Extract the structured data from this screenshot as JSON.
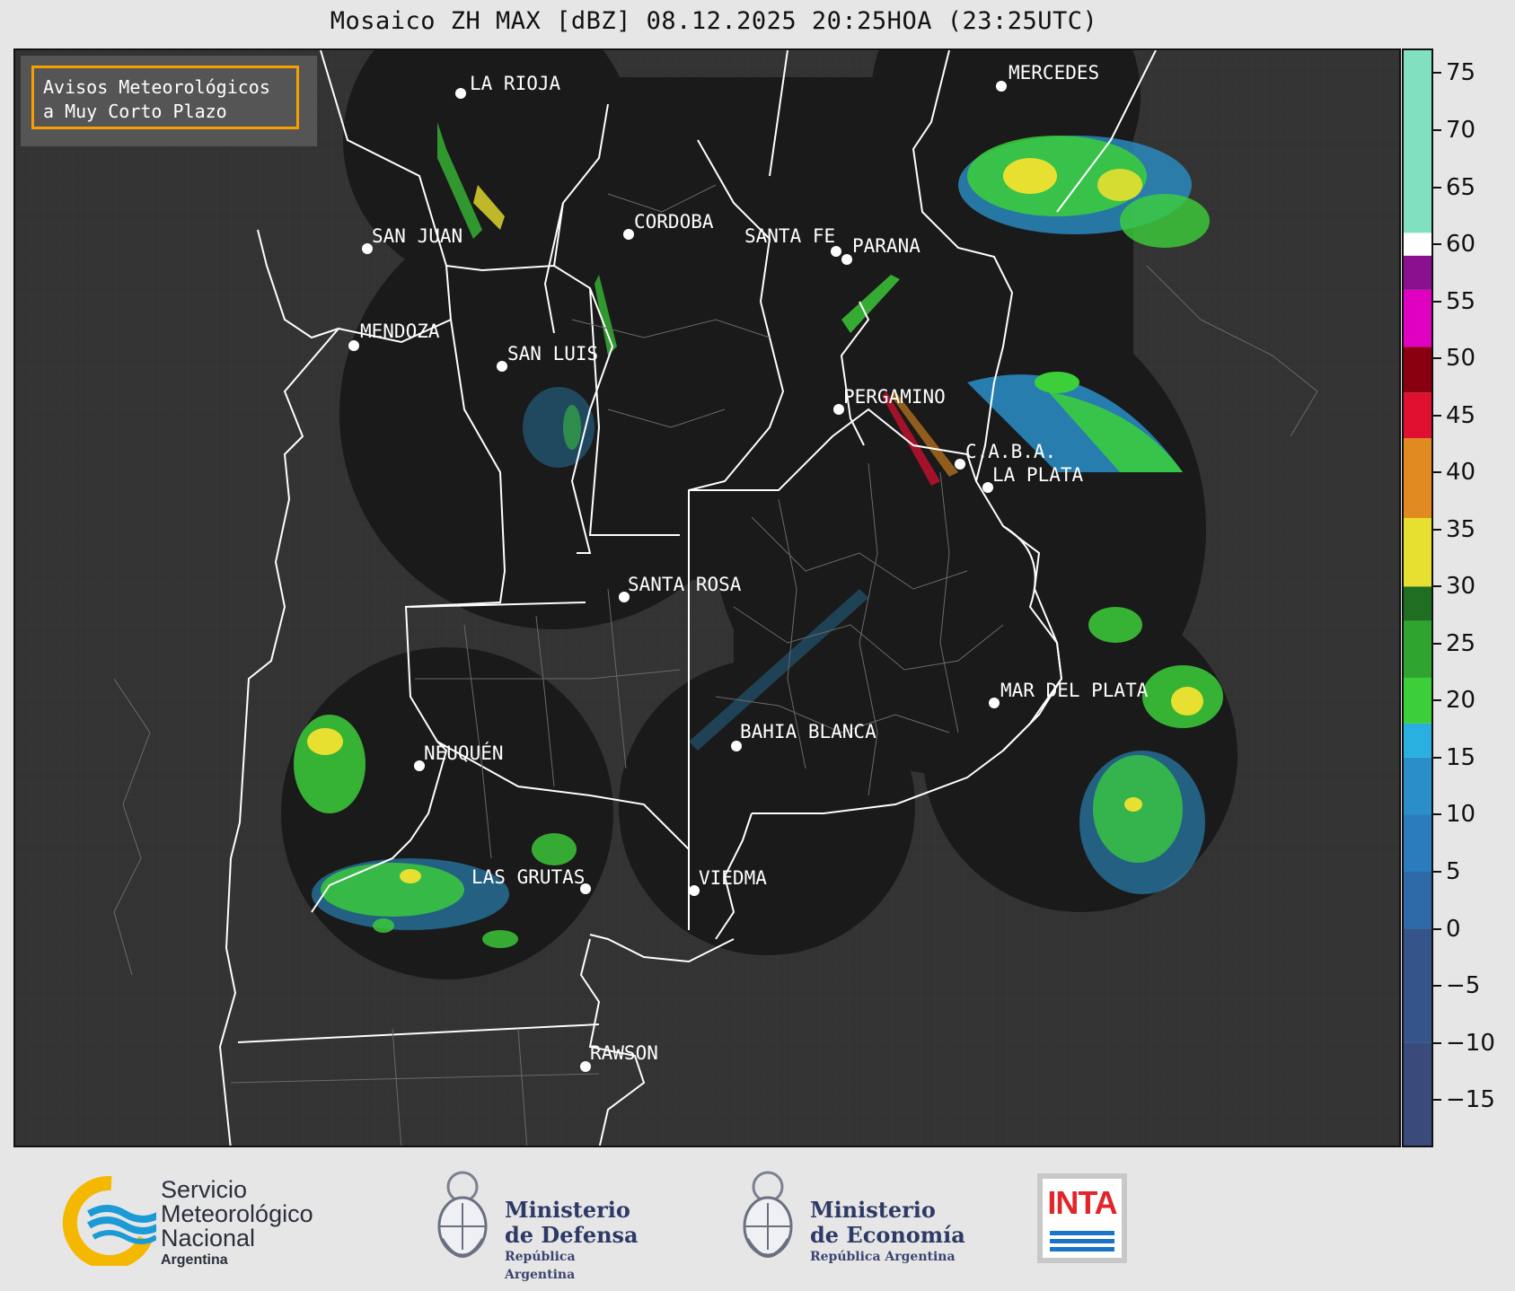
{
  "title": "Mosaico ZH MAX [dBZ] 08.12.2025 20:25HOA (23:25UTC)",
  "notice": {
    "line1": "Avisos Meteorológicos",
    "line2": "a Muy Corto Plazo"
  },
  "cities": [
    {
      "name": "LA RIOJA"
    },
    {
      "name": "SAN JUAN"
    },
    {
      "name": "CORDOBA"
    },
    {
      "name": "SANTA FE"
    },
    {
      "name": "PARANA"
    },
    {
      "name": "MERCEDES"
    },
    {
      "name": "MENDOZA"
    },
    {
      "name": "SAN LUIS"
    },
    {
      "name": "PERGAMINO"
    },
    {
      "name": "C.A.B.A."
    },
    {
      "name": "LA PLATA"
    },
    {
      "name": "SANTA ROSA"
    },
    {
      "name": "MAR DEL PLATA"
    },
    {
      "name": "BAHIA BLANCA"
    },
    {
      "name": "NEUQUÉN"
    },
    {
      "name": "LAS GRUTAS"
    },
    {
      "name": "VIEDMA"
    },
    {
      "name": "RAWSON"
    }
  ],
  "colorbar": {
    "unit": "dBZ",
    "min": -19,
    "max": 77,
    "ticks": [
      75,
      70,
      65,
      60,
      55,
      50,
      45,
      40,
      35,
      30,
      25,
      20,
      15,
      10,
      5,
      0,
      -5,
      -10,
      -15
    ],
    "tick_labels": [
      "75",
      "70",
      "65",
      "60",
      "55",
      "50",
      "45",
      "40",
      "35",
      "30",
      "25",
      "20",
      "15",
      "10",
      "5",
      "0",
      "−5",
      "−10",
      "−15"
    ],
    "colors": {
      "weak": "#3a4a7a",
      "blue": "#2a8fc8",
      "cyan": "#2ab0e0",
      "green": "#3ccf3a",
      "dark_green": "#1f6e22",
      "yellow": "#e8e030",
      "orange": "#e08a20",
      "red": "#e01030",
      "dark_red": "#8a0010",
      "magenta": "#e000c0",
      "purple": "#8a1090",
      "white": "#ffffff",
      "mint": "#80e0c0"
    }
  },
  "footer": {
    "smn": {
      "line1": "Servicio",
      "line2": "Meteorológico",
      "line3": "Nacional",
      "line4": "Argentina",
      "accent": "#f5b800",
      "wave": "#1b9ad6"
    },
    "defensa": {
      "line1": "Ministerio",
      "line2": "de Defensa",
      "line3": "República Argentina"
    },
    "economia": {
      "line1": "Ministerio",
      "line2": "de Economía",
      "line3": "República Argentina"
    },
    "inta": {
      "text": "INTA",
      "red": "#e0262b",
      "blue": "#1b74c8"
    }
  }
}
